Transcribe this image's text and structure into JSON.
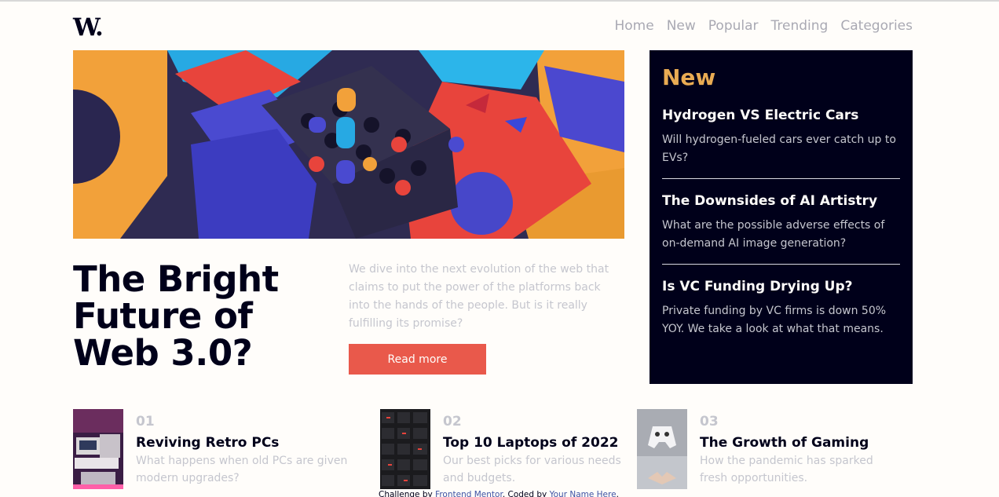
{
  "header": {
    "logo": "W.",
    "nav": [
      "Home",
      "New",
      "Popular",
      "Trending",
      "Categories"
    ]
  },
  "hero": {
    "title": "The Bright Future of Web 3.0?",
    "description": "We dive into the next evolution of the web that claims to put the power of the platforms back into the hands of the people. But is it really fulfilling its promise?",
    "button": "Read more"
  },
  "new_section": {
    "heading": "New",
    "items": [
      {
        "title": "Hydrogen VS Electric Cars",
        "desc": "Will hydrogen-fueled cars ever catch up to EVs?"
      },
      {
        "title": "The Downsides of AI Artistry",
        "desc": "What are the possible adverse effects of on-demand AI image generation?"
      },
      {
        "title": "Is VC Funding Drying Up?",
        "desc": "Private funding by VC firms is down 50% YOY. We take a look at what that means."
      }
    ]
  },
  "articles": [
    {
      "num": "01",
      "title": "Reviving Retro PCs",
      "desc": "What happens when old PCs are given modern upgrades?"
    },
    {
      "num": "02",
      "title": "Top 10 Laptops of 2022",
      "desc": "Our best picks for various needs and budgets."
    },
    {
      "num": "03",
      "title": "The Growth of Gaming",
      "desc": "How the pandemic has sparked fresh opportunities."
    }
  ],
  "footer": {
    "prefix": "Challenge by",
    "link1": "Frontend Mentor",
    "middle": ". Coded by",
    "link2": "Your Name Here",
    "suffix": "."
  },
  "colors": {
    "accent_red": "#e9594b",
    "accent_orange": "#e9ab53",
    "dark_navy": "#00001a",
    "off_white": "#fffdfa",
    "grayish_blue": "#c5c6ce"
  }
}
